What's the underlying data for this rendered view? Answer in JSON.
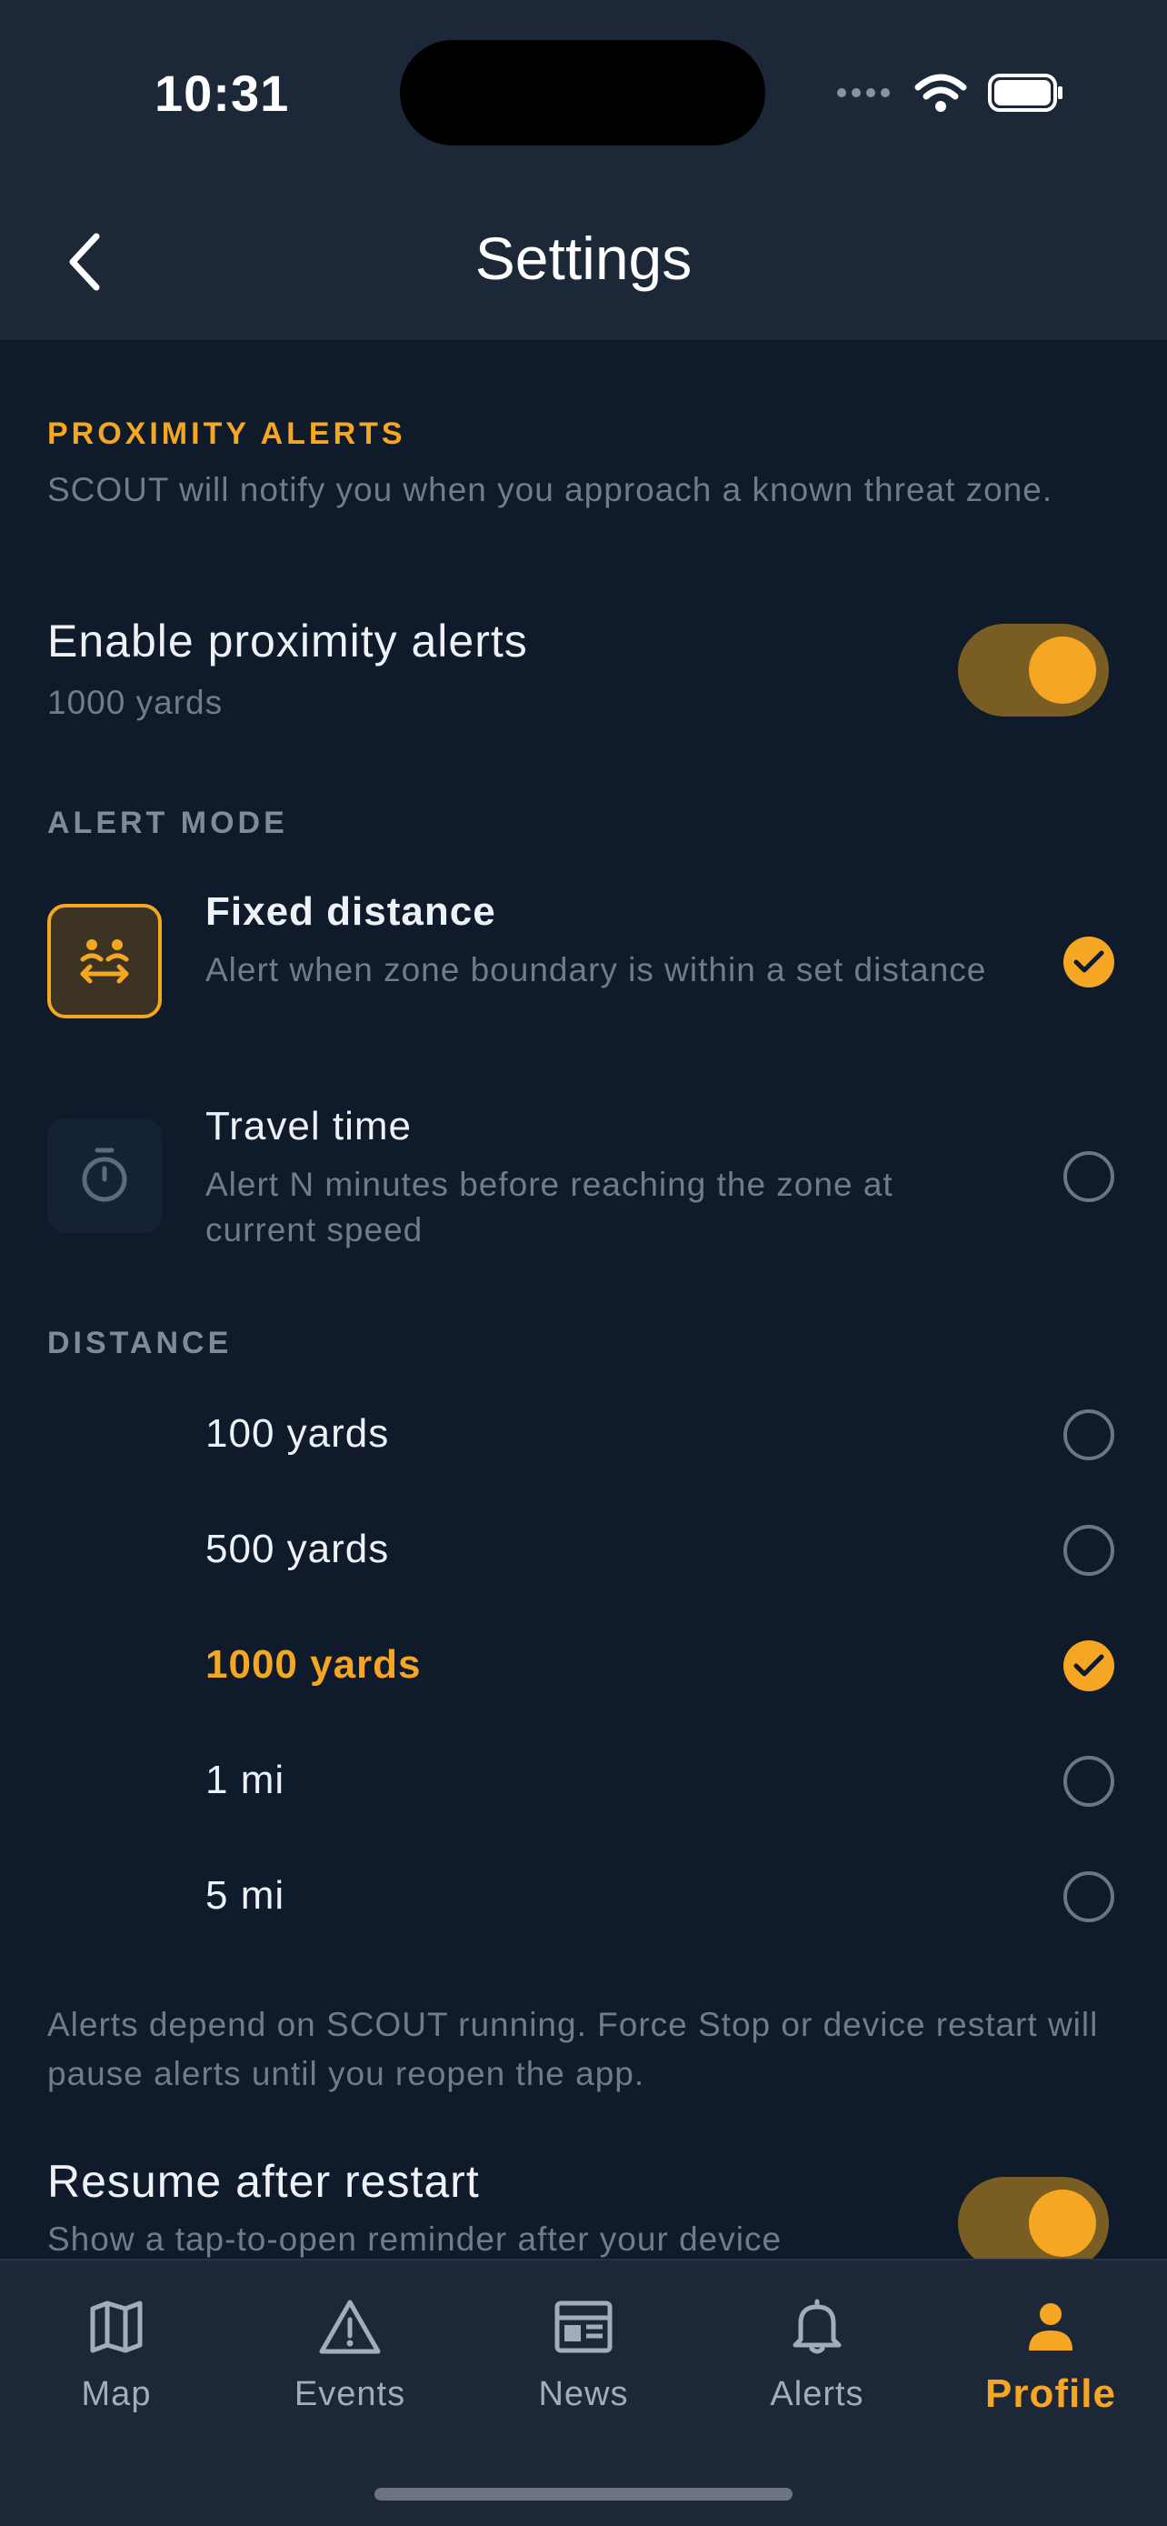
{
  "status_bar": {
    "time": "10:31"
  },
  "header": {
    "title": "Settings",
    "back_icon": "chevron-left-icon"
  },
  "proximity": {
    "section_title": "PROXIMITY ALERTS",
    "description": "SCOUT will notify you when you approach a known threat zone.",
    "enable_title": "Enable proximity alerts",
    "enable_subtitle": "1000 yards",
    "enabled": true
  },
  "alert_mode": {
    "section_title": "ALERT MODE",
    "options": [
      {
        "title": "Fixed distance",
        "subtitle": "Alert when zone boundary is within a set distance",
        "icon": "distance-icon",
        "selected": true
      },
      {
        "title": "Travel time",
        "subtitle": "Alert N minutes before reaching the zone at current speed",
        "icon": "stopwatch-icon",
        "selected": false
      }
    ]
  },
  "distance": {
    "section_title": "DISTANCE",
    "options": [
      {
        "label": "100 yards",
        "selected": false
      },
      {
        "label": "500 yards",
        "selected": false
      },
      {
        "label": "1000 yards",
        "selected": true
      },
      {
        "label": "1 mi",
        "selected": false
      },
      {
        "label": "5 mi",
        "selected": false
      }
    ]
  },
  "footer_note": "Alerts depend on SCOUT running. Force Stop or device restart will pause alerts until you reopen the app.",
  "resume": {
    "title": "Resume after restart",
    "subtitle": "Show a tap-to-open reminder after your device",
    "enabled": true
  },
  "tabs": [
    {
      "label": "Map",
      "icon": "map-icon",
      "active": false
    },
    {
      "label": "Events",
      "icon": "warning-icon",
      "active": false
    },
    {
      "label": "News",
      "icon": "newspaper-icon",
      "active": false
    },
    {
      "label": "Alerts",
      "icon": "bell-icon",
      "active": false
    },
    {
      "label": "Profile",
      "icon": "person-icon",
      "active": true
    }
  ],
  "colors": {
    "accent": "#f5a623",
    "background": "#0f1a2a",
    "header": "#1c2738"
  }
}
